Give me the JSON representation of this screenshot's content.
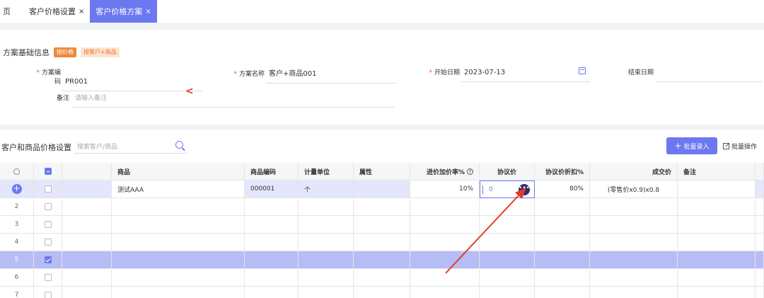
{
  "tabs": [
    {
      "label": "页",
      "active": false,
      "closable": false
    },
    {
      "label": "客户价格设置",
      "active": false,
      "closable": true
    },
    {
      "label": "客户价格方案",
      "active": true,
      "closable": true
    }
  ],
  "basic_info": {
    "title": "方案基础信息",
    "badges": [
      "按价格",
      "按客户+商品"
    ],
    "fields": {
      "code": {
        "label": "方案编码",
        "value": "PR001",
        "required": true
      },
      "name": {
        "label": "方案名称",
        "value": "客户+商品001",
        "required": true
      },
      "start_date": {
        "label": "开始日期",
        "value": "2023-07-13",
        "required": true
      },
      "end_date": {
        "label": "结束日期",
        "value": ""
      },
      "remark": {
        "label": "备注",
        "placeholder": "请输入备注"
      }
    }
  },
  "price_settings": {
    "title": "客户和商品价格设置",
    "search_placeholder": "搜索客户/商品",
    "batch_entry_label": "批量录入",
    "batch_op_label": "批量操作",
    "columns": [
      "",
      "",
      "",
      "商品",
      "商品编码",
      "计量单位",
      "属性",
      "进价加价率%",
      "协议价",
      "协议价折扣%",
      "成交价",
      "备注"
    ],
    "rows": [
      {
        "index": "",
        "product": "测试AAA",
        "code": "000001",
        "unit": "个",
        "attr": "",
        "markup": "10%",
        "agreed": "0",
        "discount": "80%",
        "deal": "(零售价x0.9)x0.8",
        "remark": ""
      },
      {
        "index": "2"
      },
      {
        "index": "3"
      },
      {
        "index": "4"
      },
      {
        "index": "5",
        "selected": true
      },
      {
        "index": "6"
      },
      {
        "index": "7"
      }
    ]
  },
  "colors": {
    "accent": "#6c78f0",
    "badge": "#f0883a",
    "arrow": "#e23a2a"
  },
  "icons": [
    "close-icon",
    "calendar-icon",
    "search-icon",
    "plus-icon",
    "edit-icon",
    "settings-icon",
    "help-icon",
    "more-icon",
    "add-icon"
  ]
}
